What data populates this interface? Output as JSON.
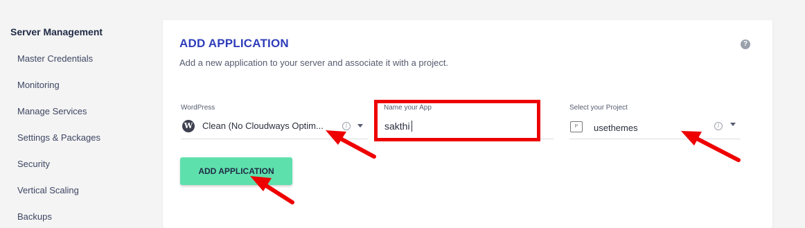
{
  "sidebar": {
    "title": "Server Management",
    "items": [
      {
        "label": "Master Credentials"
      },
      {
        "label": "Monitoring"
      },
      {
        "label": "Manage Services"
      },
      {
        "label": "Settings & Packages"
      },
      {
        "label": "Security"
      },
      {
        "label": "Vertical Scaling"
      },
      {
        "label": "Backups"
      }
    ]
  },
  "card": {
    "title": "ADD APPLICATION",
    "subtitle": "Add a new application to your server and associate it with a project.",
    "help_icon": "?"
  },
  "form": {
    "application": {
      "label": "WordPress",
      "value": "Clean (No Cloudways Optim...",
      "icon": "wordpress-icon"
    },
    "app_name": {
      "label": "Name your App",
      "value": "sakthi"
    },
    "project": {
      "label": "Select your Project",
      "value": "usethemes",
      "icon": "project-icon"
    },
    "submit_label": "ADD APPLICATION"
  },
  "colors": {
    "accent": "#2e3dbb",
    "button": "#5ee0ad",
    "annotation": "#ee0000"
  }
}
